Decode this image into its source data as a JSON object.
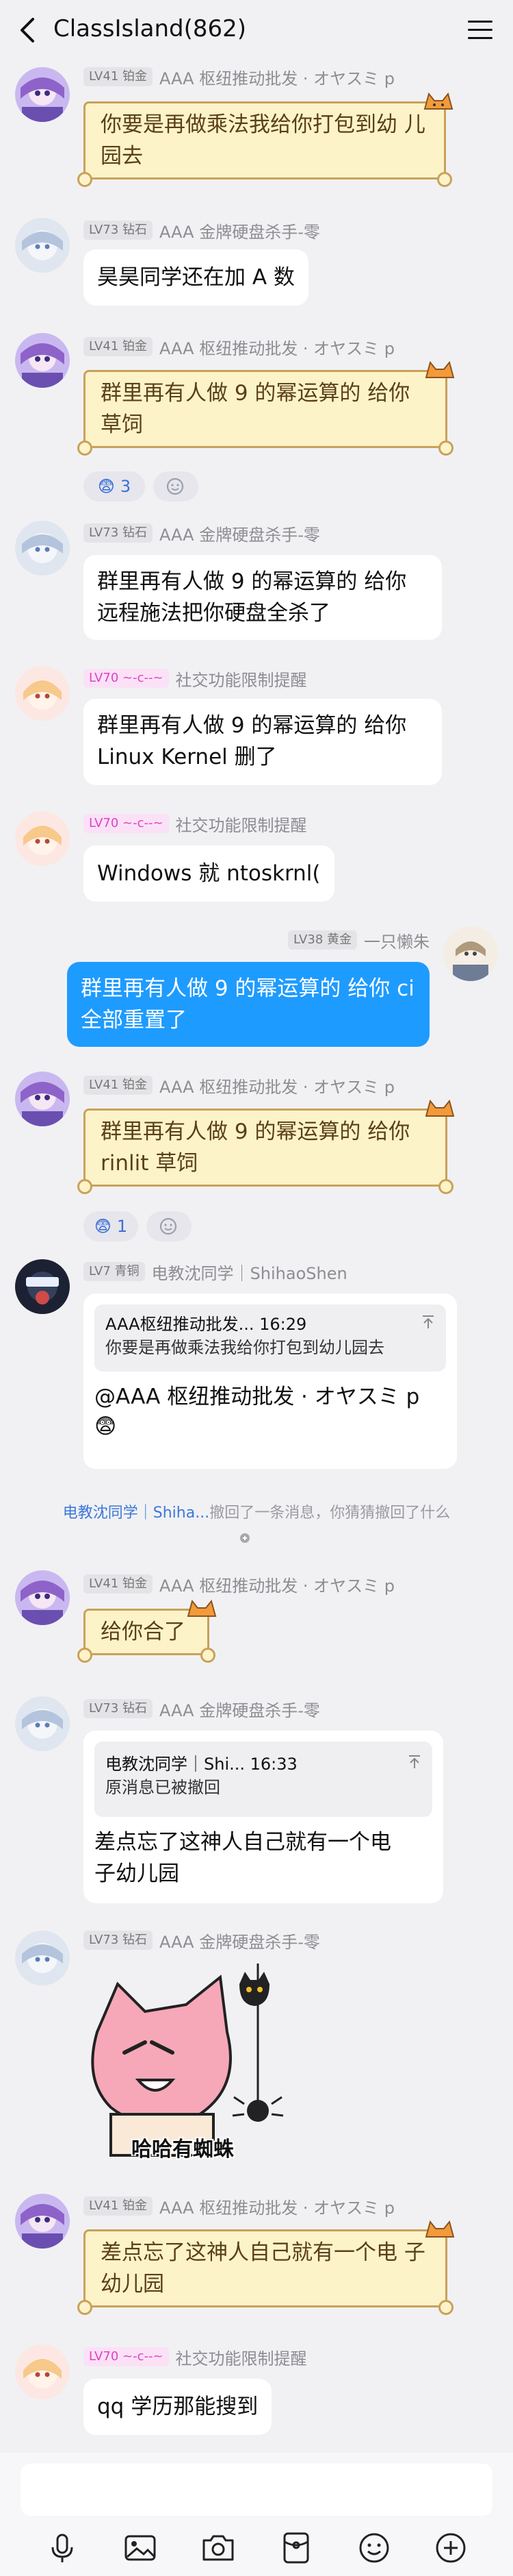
{
  "header": {
    "title": "ClassIsland(862)"
  },
  "messages": [
    {
      "level": "LV41 铂金",
      "name": "AAA 枢纽推动批发 · オヤスミ p",
      "lines": [
        "你要是再做乘法我给你打包到幼",
        "儿园去"
      ]
    },
    {
      "level": "LV73 钻石",
      "name": "AAA 金牌硬盘杀手-零",
      "lines": [
        "昊昊同学还在加 A 数"
      ]
    },
    {
      "level": "LV41 铂金",
      "name": "AAA 枢纽推动批发 · オヤスミ p",
      "lines": [
        "群里再有人做 9 的幂运算的 给你",
        "草饲"
      ],
      "reaction": {
        "emoji": "😨",
        "count": "3"
      }
    },
    {
      "level": "LV73 钻石",
      "name": "AAA 金牌硬盘杀手-零",
      "lines": [
        "群里再有人做 9 的幂运算的 给你",
        "远程施法把你硬盘全杀了"
      ]
    },
    {
      "level": "LV70 ~-c--~",
      "name": "社交功能限制提醒",
      "lines": [
        "群里再有人做 9 的幂运算的 给你",
        "Linux Kernel 删了"
      ]
    },
    {
      "level": "LV70 ~-c--~",
      "name": "社交功能限制提醒",
      "lines": [
        "Windows 就 ntoskrnl("
      ]
    },
    {
      "level": "LV38 黄金",
      "name": "一只懒朱",
      "lines": [
        "群里再有人做 9 的幂运算的 给你",
        "ci 全部重置了"
      ]
    },
    {
      "level": "LV41 铂金",
      "name": "AAA 枢纽推动批发 · オヤスミ p",
      "lines": [
        "群里再有人做 9 的幂运算的 给你",
        "rinlit 草饲"
      ],
      "reaction": {
        "emoji": "😨",
        "count": "1"
      }
    },
    {
      "level": "LV7 青铜",
      "name": "电教沈同学｜ShihaoShen",
      "quote": {
        "author": "AAA枢纽推动批发... 16:29",
        "text": "你要是再做乘法我给你打包到幼儿园去"
      },
      "lines": [
        "@AAA 枢纽推动批发 · オヤスミ p",
        "😨"
      ]
    },
    {
      "level": "LV41 铂金",
      "name": "AAA 枢纽推动批发 · オヤスミ p",
      "lines": [
        "给你合了"
      ]
    },
    {
      "level": "LV73 钻石",
      "name": "AAA 金牌硬盘杀手-零",
      "quote": {
        "author": "电教沈同学｜Shi... 16:33",
        "text": "原消息已被撤回"
      },
      "lines": [
        "差点忘了这神人自己就有一个电",
        "子幼儿园"
      ]
    },
    {
      "level": "LV73 钻石",
      "name": "AAA 金牌硬盘杀手-零",
      "sticker": "哈哈有蜘蛛"
    },
    {
      "level": "LV41 铂金",
      "name": "AAA 枢纽推动批发 · オヤスミ p",
      "lines": [
        "差点忘了这神人自己就有一个电",
        "子幼儿园"
      ]
    },
    {
      "level": "LV70 ~-c--~",
      "name": "社交功能限制提醒",
      "lines": [
        "qq 学历那能搜到"
      ]
    }
  ],
  "recall": {
    "link": "电教沈同学｜Shiha...",
    "text": "撤回了一条消息，你猜猜撤回了什么"
  },
  "toolbar": [
    "mic-icon",
    "image-icon",
    "camera-icon",
    "red-packet-icon",
    "emoji-icon",
    "plus-icon"
  ]
}
